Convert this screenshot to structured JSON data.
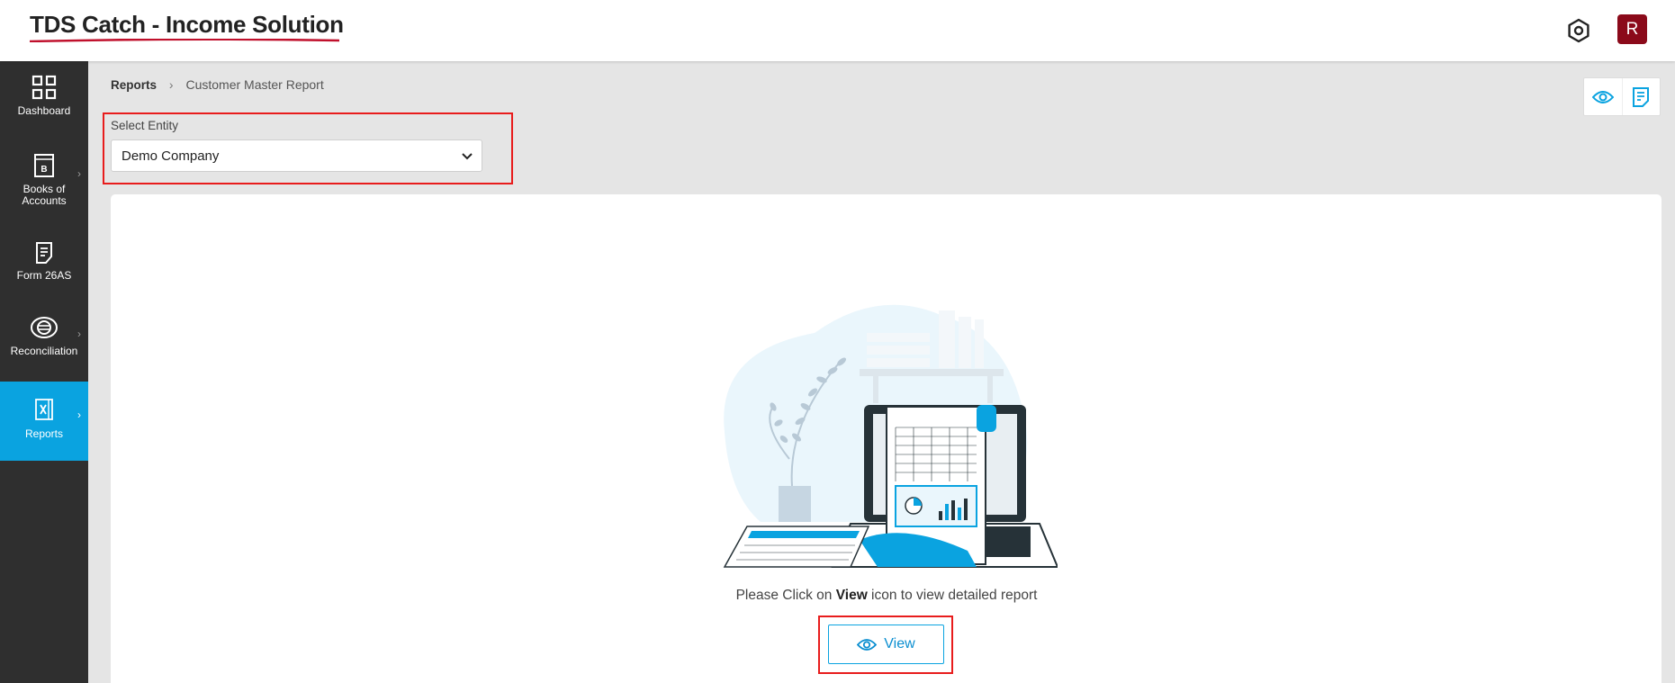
{
  "app": {
    "title": "TDS Catch - Income Solution",
    "accent_color": "#0aa3e0",
    "brand_red": "#c0102c"
  },
  "header": {
    "settings_icon": "hexagon-settings-icon",
    "avatar_initial": "R",
    "avatar_color": "#8b0a1a"
  },
  "sidebar": {
    "items": [
      {
        "label": "Dashboard",
        "icon": "grid-icon",
        "has_submenu": false,
        "active": false
      },
      {
        "label": "Books of Accounts",
        "icon": "ledger-book-icon",
        "has_submenu": true,
        "active": false
      },
      {
        "label": "Form 26AS",
        "icon": "form-document-icon",
        "has_submenu": false,
        "active": false
      },
      {
        "label": "Reconciliation",
        "icon": "reconcile-icon",
        "has_submenu": true,
        "active": false
      },
      {
        "label": "Reports",
        "icon": "excel-report-icon",
        "has_submenu": true,
        "active": true
      }
    ]
  },
  "breadcrumb": {
    "root": "Reports",
    "separator": "›",
    "current": "Customer Master Report"
  },
  "toolbar": {
    "view_icon": "eye-icon",
    "report_icon": "report-document-icon"
  },
  "entity": {
    "label": "Select Entity",
    "selected": "Demo Company"
  },
  "main": {
    "hint_prefix": "Please Click on ",
    "hint_bold": "View",
    "hint_suffix": " icon to view detailed report",
    "view_button_label": "View"
  }
}
